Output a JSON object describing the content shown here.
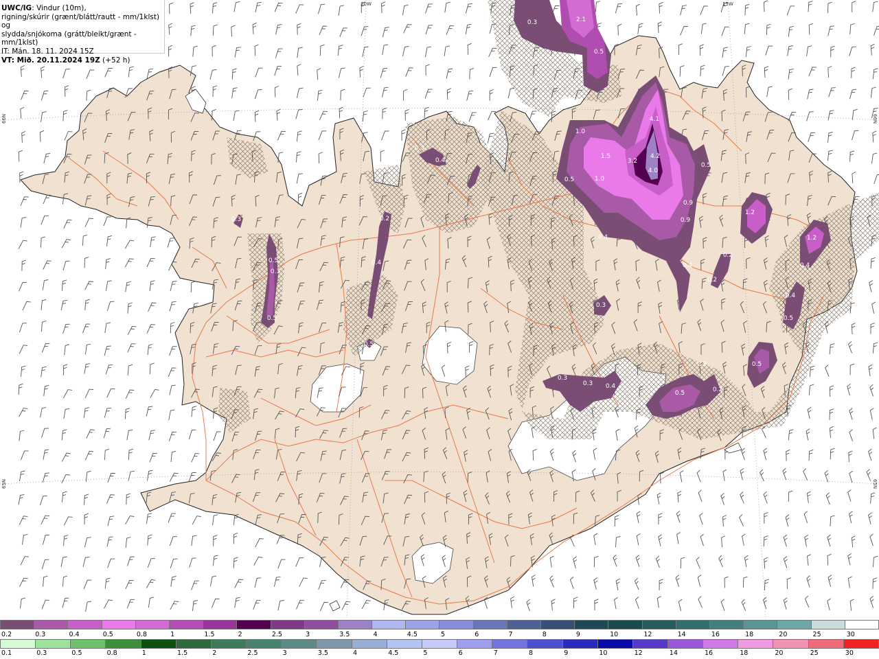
{
  "header": {
    "title_bold": "UWC/IG",
    "title_rest": ": Vindur (10m),",
    "line2": "rigning/skúrir (grænt/blátt/rautt - mm/1klst) og",
    "line3": "slydda/snjókoma (grátt/bleikt/grænt - mm/1klst)",
    "line4": "IT: Mán. 18. 11. 2024 15Z",
    "line5_bold": "VT: Mið. 20.11.2024 19Z",
    "line5_rest": " (+52 h)"
  },
  "grid_labels": {
    "lon_20w": "20W",
    "lon_15w": "15W",
    "lat_66n_left": "66N",
    "lat_66n_right": "66N",
    "lat_65n_left": "65N",
    "lat_65n_right": "65N"
  },
  "precip_labels": [
    {
      "text": "0.3"
    },
    {
      "text": "2.1"
    },
    {
      "text": "0.5"
    },
    {
      "text": "1.0"
    },
    {
      "text": "1.5"
    },
    {
      "text": "3.2"
    },
    {
      "text": "4.1"
    },
    {
      "text": "4.2"
    },
    {
      "text": "4.0"
    },
    {
      "text": "0.5"
    },
    {
      "text": "1.0"
    },
    {
      "text": "0.5"
    },
    {
      "text": "0.9"
    },
    {
      "text": "0.9"
    },
    {
      "text": "0.4"
    },
    {
      "text": "1.2"
    },
    {
      "text": "1.2"
    },
    {
      "text": "0.4"
    },
    {
      "text": "0.2"
    },
    {
      "text": "0.4"
    },
    {
      "text": "0.2"
    },
    {
      "text": "0.3"
    },
    {
      "text": "0.4"
    },
    {
      "text": "0.5"
    },
    {
      "text": "0.3"
    },
    {
      "text": "0.3"
    },
    {
      "text": "0.4"
    },
    {
      "text": "0.5"
    },
    {
      "text": "0.2"
    },
    {
      "text": "0.5"
    },
    {
      "text": "0.2"
    },
    {
      "text": "0.5"
    },
    {
      "text": "0.3"
    },
    {
      "text": "0.4"
    },
    {
      "text": "0.5"
    },
    {
      "text": "0.3"
    },
    {
      "text": "0.4"
    },
    {
      "text": "0.3"
    },
    {
      "text": "0.2"
    },
    {
      "text": "0.5"
    }
  ],
  "legend_snow": {
    "labels": [
      "0.2",
      "0.3",
      "0.4",
      "0.5",
      "0.8",
      "1",
      "1.5",
      "2",
      "2.5",
      "3",
      "3.5",
      "4",
      "4.5",
      "5",
      "6",
      "7",
      "8",
      "9",
      "10",
      "12",
      "14",
      "16",
      "18",
      "20",
      "25",
      "30"
    ],
    "colors": [
      "#7a4d74",
      "#a85aa6",
      "#c85ec8",
      "#ea7aea",
      "#d26cd2",
      "#b64db6",
      "#9a359a",
      "#52004f",
      "#7f3a87",
      "#8f4f9e",
      "#9c82c4",
      "#b0b6ee",
      "#9ca0e6",
      "#888cd8",
      "#6a76b8",
      "#4f6094",
      "#355074",
      "#1e4854",
      "#1a4a4a",
      "#265c5c",
      "#336e6e",
      "#428080",
      "#5a9494",
      "#6ea6a6",
      "#c8dcdc",
      "#ffffff"
    ]
  },
  "legend_rain": {
    "labels": [
      "0.1",
      "0.3",
      "0.5",
      "0.8",
      "1",
      "1.5",
      "2",
      "2.5",
      "3",
      "3.5",
      "4",
      "4.5",
      "5",
      "6",
      "7",
      "8",
      "9",
      "10",
      "12",
      "14",
      "16",
      "18",
      "20",
      "25",
      "30"
    ],
    "colors": [
      "#d6fad6",
      "#9ee09e",
      "#6ebe6e",
      "#3e8e3e",
      "#0f4f0f",
      "#2f6a3f",
      "#3f7a5a",
      "#4a8272",
      "#5e8a86",
      "#7c98a8",
      "#98aed2",
      "#b4c4f2",
      "#c6caf8",
      "#9e9ef0",
      "#7474de",
      "#4e4ed2",
      "#2a2abe",
      "#0a0aa8",
      "#5838c8",
      "#9858d8",
      "#d078e8",
      "#f09ae0",
      "#f292b2",
      "#f06a7a",
      "#f02222"
    ]
  },
  "colors": {
    "land": "#f1e1d1",
    "roads": "#e8784a",
    "sea": "#ffffff",
    "glacier": "#ffffff",
    "sleet_hatch": "#8c8070"
  }
}
